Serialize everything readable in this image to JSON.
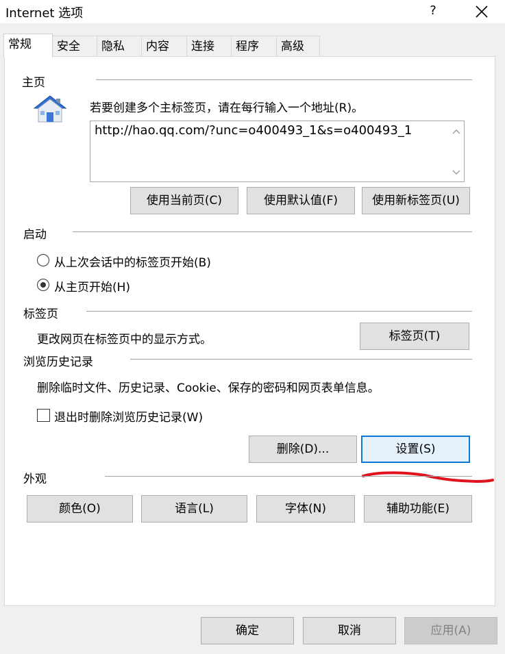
{
  "window": {
    "title": "Internet 选项",
    "help_label": "?",
    "close_icon": "close-icon"
  },
  "tabs": [
    {
      "label": "常规",
      "active": true
    },
    {
      "label": "安全"
    },
    {
      "label": "隐私"
    },
    {
      "label": "内容"
    },
    {
      "label": "连接"
    },
    {
      "label": "程序"
    },
    {
      "label": "高级"
    }
  ],
  "homepage": {
    "title": "主页",
    "icon": "house-icon",
    "instruction": "若要创建多个主标签页，请在每行输入一个地址(R)。",
    "url_value": "http://hao.qq.com/?unc=o400493_1&s=o400493_1",
    "btn_current": "使用当前页(C)",
    "btn_default": "使用默认值(F)",
    "btn_newtab": "使用新标签页(U)"
  },
  "startup": {
    "title": "启动",
    "option_last_session": "从上次会话中的标签页开始(B)",
    "option_homepage": "从主页开始(H)",
    "selected": "homepage"
  },
  "tabs_section": {
    "title": "标签页",
    "description": "更改网页在标签页中的显示方式。",
    "btn_tabs": "标签页(T)"
  },
  "history": {
    "title": "浏览历史记录",
    "description": "删除临时文件、历史记录、Cookie、保存的密码和网页表单信息。",
    "checkbox_label": "退出时删除浏览历史记录(W)",
    "checkbox_checked": false,
    "btn_delete": "删除(D)...",
    "btn_settings": "设置(S)"
  },
  "appearance": {
    "title": "外观",
    "btn_colors": "颜色(O)",
    "btn_languages": "语言(L)",
    "btn_fonts": "字体(N)",
    "btn_accessibility": "辅助功能(E)"
  },
  "footer": {
    "btn_ok": "确定",
    "btn_cancel": "取消",
    "btn_apply": "应用(A)"
  },
  "colors": {
    "annotation": "#e0141e",
    "focus_border": "#0a78d7"
  }
}
